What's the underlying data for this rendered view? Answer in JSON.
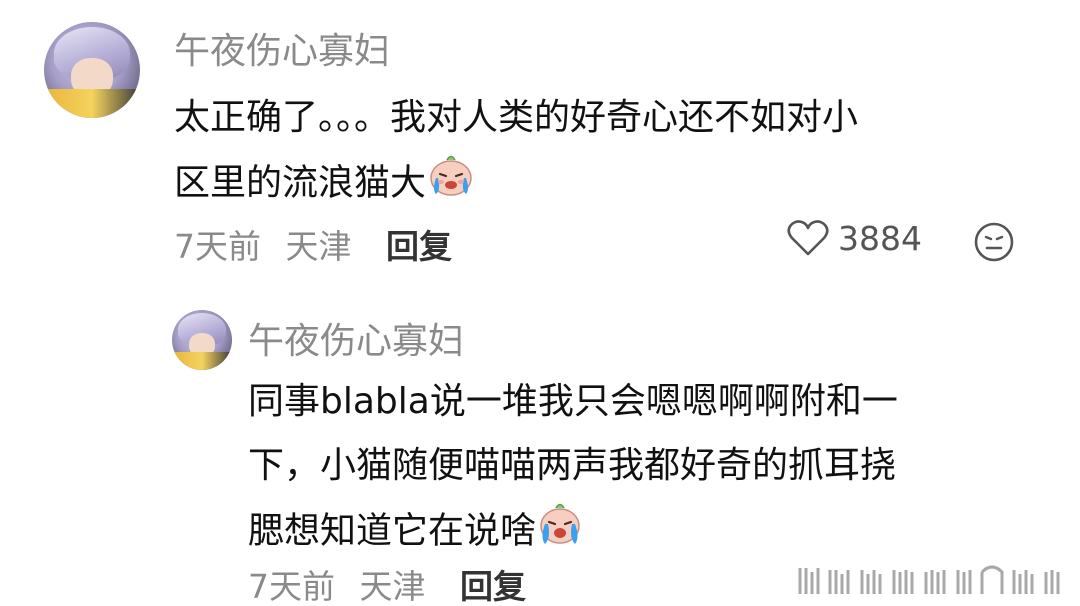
{
  "comments": [
    {
      "username": "午夜伤心寡妇",
      "content_lines": [
        "太正确了。。。我对人类的好奇心还不如对小",
        "区里的流浪猫大"
      ],
      "emoji": "crying-emoji",
      "time": "7天前",
      "location": "天津",
      "reply_label": "回复",
      "like_count": "3884",
      "like_icon": "heart-outline-icon",
      "dislike_icon": "neutral-face-icon"
    },
    {
      "username": "午夜伤心寡妇",
      "content_lines": [
        "同事blabla说一堆我只会嗯嗯啊啊附和一",
        "下，小猫随便喵喵两声我都好奇的抓耳挠",
        "腮想知道它在说啥"
      ],
      "emoji": "crying-emoji",
      "time": "7天前",
      "location": "天津",
      "reply_label": "回复"
    }
  ],
  "watermark": "watermark-logo",
  "colors": {
    "username": "#8a8a8a",
    "content": "#111111",
    "meta": "#8a8a8a",
    "reply": "#333333",
    "emoji_face": "#f6cfc0",
    "emoji_tear": "#3aa0f0"
  }
}
